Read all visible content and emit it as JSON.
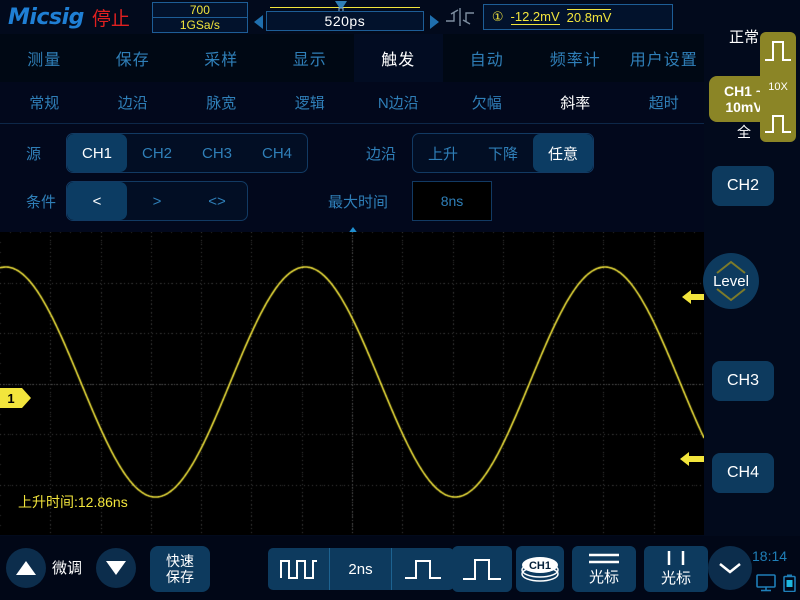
{
  "brand": {
    "name": "Micsig",
    "run_state": "停止"
  },
  "acquisition": {
    "memory_depth": "700",
    "sample_rate": "1GSa/s"
  },
  "timebase_top": {
    "value": "520ps"
  },
  "measure": {
    "channel_mark": "①",
    "value_low": "-12.2mV",
    "value_high": "20.8mV"
  },
  "menu": {
    "items": [
      {
        "label": "测量",
        "active": false
      },
      {
        "label": "保存",
        "active": false
      },
      {
        "label": "采样",
        "active": false
      },
      {
        "label": "显示",
        "active": false
      },
      {
        "label": "触发",
        "active": true
      },
      {
        "label": "自动",
        "active": false
      },
      {
        "label": "频率计",
        "active": false
      },
      {
        "label": "用户设置",
        "active": false
      }
    ]
  },
  "submenu": {
    "items": [
      {
        "label": "常规",
        "active": false
      },
      {
        "label": "边沿",
        "active": false
      },
      {
        "label": "脉宽",
        "active": false
      },
      {
        "label": "逻辑",
        "active": false
      },
      {
        "label": "N边沿",
        "active": false
      },
      {
        "label": "欠幅",
        "active": false
      },
      {
        "label": "斜率",
        "active": true
      },
      {
        "label": "超时",
        "active": false
      }
    ]
  },
  "settings": {
    "source_label": "源",
    "source_options": [
      "CH1",
      "CH2",
      "CH3",
      "CH4"
    ],
    "source_selected": "CH1",
    "edge_label": "边沿",
    "edge_options": [
      "上升",
      "下降",
      "任意"
    ],
    "edge_selected": "任意",
    "condition_label": "条件",
    "condition_options": [
      "<",
      ">",
      "<>"
    ],
    "condition_selected": "<",
    "maxtime_label": "最大时间",
    "maxtime_value": "8ns"
  },
  "waveform": {
    "rise_time_label": "上升时间:12.86ns",
    "channel_marker": "1",
    "trace_color": "#f2e53c",
    "grid_color": "#3a3a3a"
  },
  "sidebar": {
    "trigger_mode": "正常",
    "ch1_label": "CH1 ~",
    "ch1_scale": "10mV",
    "ch1_bw": "全",
    "probe_ratio": "10X",
    "ch2": "CH2",
    "ch3": "CH3",
    "ch4": "CH4",
    "level": "Level"
  },
  "bottom": {
    "fine_label": "微调",
    "quick_save": "快速\n保存",
    "quick_save_line1": "快速",
    "quick_save_line2": "保存",
    "timebase_value": "2ns",
    "ch1_stack": "CH1",
    "h_cursor_label": "光标",
    "v_cursor_label": "光标",
    "clock": "18:14"
  },
  "colors": {
    "accent_blue": "#1f7fd4",
    "trace_yellow": "#f2e53c",
    "stop_red": "#e02020",
    "olive": "#8b8526",
    "panel_blue": "#0d3a5e"
  },
  "chart_data": {
    "type": "line",
    "title": "",
    "xlabel": "",
    "ylabel": "",
    "series": [
      {
        "name": "CH1",
        "color": "#f2e53c",
        "amplitude": 115,
        "offset": 150,
        "cycles": 2.35,
        "phase": 1.45
      }
    ],
    "grid": true,
    "divisions_x": 14,
    "divisions_y": 6
  }
}
